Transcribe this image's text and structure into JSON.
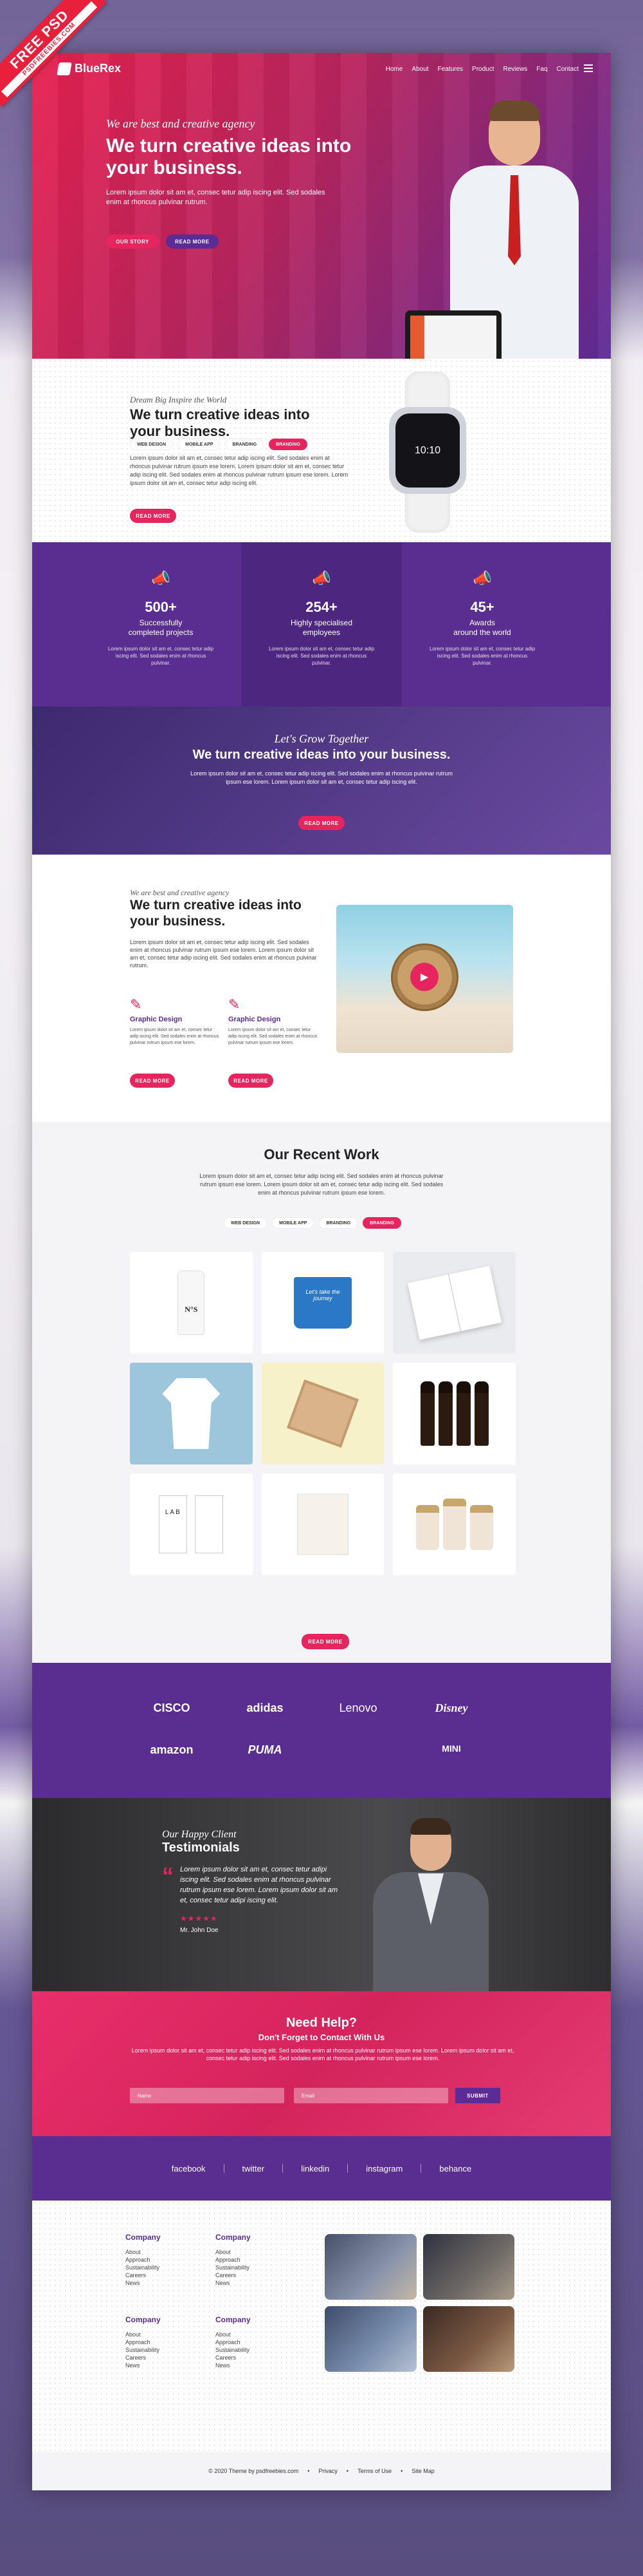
{
  "ribbon": {
    "line1": "FREE PSD",
    "line2": "PSDFREEBIES.COM"
  },
  "header": {
    "logo": "BlueRex",
    "nav": [
      "Home",
      "About",
      "Features",
      "Product",
      "Reviews",
      "Faq",
      "Contact"
    ]
  },
  "hero": {
    "tagline": "We are best and creative agency",
    "title": "We  turn creative ideas into your business.",
    "text": "Lorem ipsum dolor sit am et, consec tetur adip iscing elit. Sed sodales enim at rhoncus pulvinar rutrum.",
    "btn_story": "OUR STORY",
    "btn_more": "READ MORE"
  },
  "intro": {
    "tagline": "Dream Big Inspire the World",
    "title": "We  turn creative ideas into your business.",
    "pills": [
      "WEB DESIGN",
      "MOBILE APP",
      "BRANDING",
      "BRANDING"
    ],
    "text": "Lorem ipsum dolor sit am et, consec tetur adip iscing elit. Sed sodales enim at rhoncus pulvinar rutrum ipsum ese lorem. Lorem ipsum dolor sit am et, consec tetur adip iscing elit. Sed sodales enim at rhoncus pulvinar rutrum ipsum ese lorem. Lorem ipsum dolor sit am et, consec tetur adip iscing elit.",
    "btn": "READ MORE",
    "watch_time": "10:10"
  },
  "stats": [
    {
      "num": "500+",
      "label1": "Successfully",
      "label2": "completed projects",
      "desc": "Lorem ipsum dolor sit am et, consec tetur adip iscing elit. Sed sodales enim at rhoncus pulvinar."
    },
    {
      "num": "254+",
      "label1": "Highly specialised",
      "label2": "employees",
      "desc": "Lorem ipsum dolor sit am et, consec tetur adip iscing elit. Sed sodales enim at rhoncus pulvinar."
    },
    {
      "num": "45+",
      "label1": "Awards",
      "label2": "around the world",
      "desc": "Lorem ipsum dolor sit am et, consec tetur adip iscing elit. Sed sodales enim at rhoncus pulvinar."
    }
  ],
  "grow": {
    "tagline": "Let's Grow Together",
    "title": "We  turn creative ideas into your business.",
    "text": "Lorem ipsum dolor sit am et, consec tetur adip iscing elit. Sed sodales enim at rhoncus pulvinar rutrum ipsum ese lorem. Lorem ipsum dolor sit am et, consec tetur adip iscing elit.",
    "btn": "READ MORE"
  },
  "about": {
    "tagline": "We are best and creative agency",
    "title": "We  turn creative ideas into your business.",
    "text": "Lorem ipsum dolor sit am et, consec tetur adip iscing elit. Sed sodales enim at rhoncus pulvinar rutrum ipsum ese lorem. Lorem ipsum dolor sit am et, consec tetur adip iscing elit. Sed sodales enim at rhoncus pulvinar rutrum.",
    "features": [
      {
        "title": "Graphic Design",
        "text": "Lorem ipsum dolor sit am et, consec tetur adip iscing elit. Sed sodales enim at rhoncus pulvinar rutrum ipsum ese lorem.",
        "btn": "READ MORE"
      },
      {
        "title": "Graphic Design",
        "text": "Lorem ipsum dolor sit am et, consec tetur adip iscing elit. Sed sodales enim at rhoncus pulvinar rutrum ipsum ese lorem.",
        "btn": "READ MORE"
      }
    ]
  },
  "work": {
    "title": "Our Recent Work",
    "text": "Lorem ipsum dolor sit am et, consec tetur adip iscing elit. Sed sodales enim at rhoncus pulvinar rutrum ipsum ese lorem. Lorem ipsum dolor sit am et, consec tetur adip iscing elit. Sed sodales enim at rhoncus pulvinar rutrum ipsum ese lorem.",
    "filters": [
      "WEB DESIGN",
      "MOBILE APP",
      "BRANDING",
      "BRANDING"
    ],
    "items": [
      {
        "icon": "bottle-icon",
        "label": "N°S"
      },
      {
        "icon": "mug-icon",
        "label": "Let's take the journey"
      },
      {
        "icon": "magazine-icon",
        "label": ""
      },
      {
        "icon": "tshirt-icon",
        "label": ""
      },
      {
        "icon": "box-icon",
        "label": ""
      },
      {
        "icon": "beer-bottles-icon",
        "label": ""
      },
      {
        "icon": "tags-icon",
        "label": "LAB"
      },
      {
        "icon": "tote-bag-icon",
        "label": ""
      },
      {
        "icon": "cosmetic-bottles-icon",
        "label": ""
      }
    ],
    "btn": "READ MORE"
  },
  "clients": [
    "CISCO",
    "adidas",
    "Lenovo",
    "Disney",
    "amazon",
    "PUMA",
    "",
    "MINI"
  ],
  "testimonial": {
    "tagline": "Our Happy Client",
    "title": "Testimonials",
    "quote": "Lorem ipsum dolor sit am et, consec tetur adipi iscing elit. Sed sodales enim at rhoncus pulvinar rutrum ipsum ese lorem. Lorem ipsum dolor sit am et, consec tetur adipi iscing elit.",
    "stars": "★★★★★",
    "name": "Mr. John Doe"
  },
  "help": {
    "title": "Need Help?",
    "subtitle": "Don't Forget to Contact With Us",
    "text": "Lorem ipsum dolor sit am et, consec tetur adip iscing elit. Sed sodales enim at rhoncus pulvinar rutrum ipsum ese lorem. Lorem ipsum dolor sit am et, consec tetur adip iscing elit. Sed sodales enim at rhoncus pulvinar rutrum ipsum ese lorem.",
    "name_placeholder": "Name",
    "email_placeholder": "Email",
    "submit": "SUBMIT"
  },
  "social": [
    "facebook",
    "twitter",
    "linkedin",
    "instagram",
    "behance"
  ],
  "footer": {
    "columns": [
      {
        "title": "Company",
        "links": [
          "About",
          "Approach",
          "Sustainability",
          "Careers",
          "News"
        ]
      },
      {
        "title": "Company",
        "links": [
          "About",
          "Approach",
          "Sustainability",
          "Careers",
          "News"
        ]
      },
      {
        "title": "Company",
        "links": [
          "About",
          "Approach",
          "Sustainability",
          "Careers",
          "News"
        ]
      },
      {
        "title": "Company",
        "links": [
          "About",
          "Approach",
          "Sustainability",
          "Careers",
          "News"
        ]
      }
    ],
    "copyright": "© 2020 Theme by psdfreebies.com",
    "links": [
      "Privacy",
      "Terms of Use",
      "Site Map"
    ]
  },
  "colors": {
    "pink": "#e6245d",
    "purple": "#5a2d91"
  }
}
